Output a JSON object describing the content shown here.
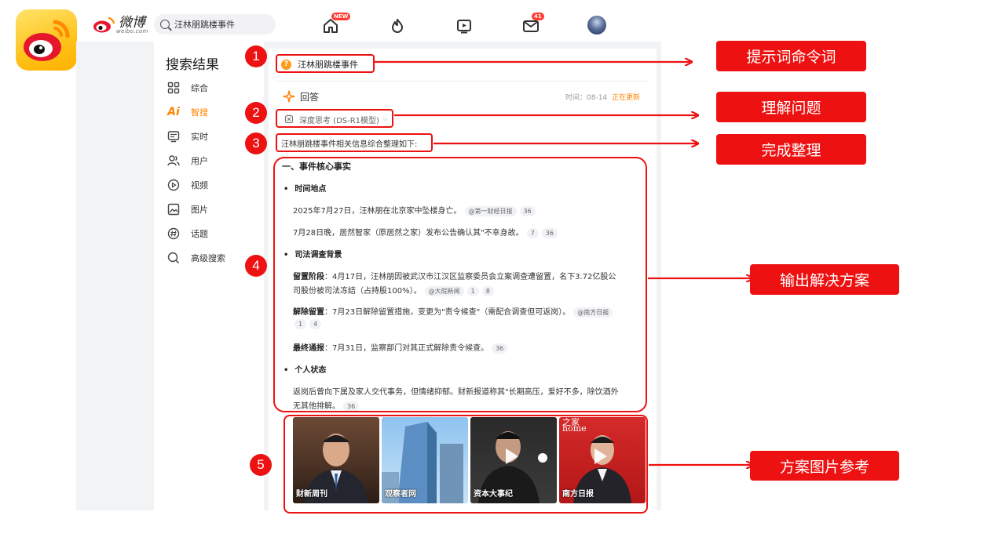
{
  "brand": {
    "name": "微博",
    "sub": "weibo.com"
  },
  "search": {
    "value": "汪林朋跳楼事件"
  },
  "nav": {
    "home_badge": "NEW",
    "mail_badge": "41"
  },
  "sidebar": {
    "title": "搜索结果",
    "items": [
      {
        "label": "综合",
        "icon": "grid-icon"
      },
      {
        "label": "智搜",
        "icon": "ai-icon"
      },
      {
        "label": "实时",
        "icon": "realtime-icon"
      },
      {
        "label": "用户",
        "icon": "users-icon"
      },
      {
        "label": "视频",
        "icon": "video-icon"
      },
      {
        "label": "图片",
        "icon": "image-icon"
      },
      {
        "label": "话题",
        "icon": "topic-icon"
      },
      {
        "label": "高级搜索",
        "icon": "search-icon"
      }
    ]
  },
  "main": {
    "query": "汪林朋跳楼事件",
    "answer_label": "回答",
    "time": "时间：08-14",
    "live": "正在更新",
    "think_label": "深度思考 (DS-R1模型)",
    "summary": "汪林朋跳楼事件相关信息综合整理如下:",
    "section1": "一、事件核心事实",
    "b1": "时间地点",
    "l1": "2025年7月27日，汪林朋在北京家中坠楼身亡。",
    "l1_tags": [
      "@第一财经日报",
      "36"
    ],
    "l2": "7月28日晚，居然智家（原居然之家）发布公告确认其\"不幸身故。",
    "l2_tags": [
      "7",
      "36"
    ],
    "b2": "司法调查背景",
    "p1_bold": "留置阶段",
    "p1_a": "：4月17日，汪林朋因被武汉市江汉区监察委员会立案调查遭留置，名下3.72亿股公",
    "p1_b": "司股份被司法冻结（占持股100%）。",
    "p1_tags": [
      "@大皖新闻",
      "1",
      "8"
    ],
    "p2_bold": "解除留置",
    "p2_a": "：7月23日解除留置措施，变更为\"责令候查\"（需配合调查但可返岗）。",
    "p2_tags": [
      "@南方日报",
      "1",
      "4"
    ],
    "p3_bold": "最终通报",
    "p3_a": "：7月31日，监察部门对其正式解除责令候查。",
    "p3_tags": [
      "36"
    ],
    "b3": "个人状态",
    "p4_a": "返岗后曾向下属及家人交代事务，但情绪抑郁。财新报道称其\"长期高压，爱好不多，除饮酒外",
    "p4_b": "无其他排解。",
    "p4_tags": [
      "36"
    ]
  },
  "images": [
    {
      "source": "财新周刊"
    },
    {
      "source": "观察者网"
    },
    {
      "source": "资本大事纪"
    },
    {
      "source": "南方日报"
    }
  ],
  "image_overlay_texts": [
    "之家",
    "home"
  ],
  "annotations": [
    {
      "num": "1",
      "label": "提示词命令词"
    },
    {
      "num": "2",
      "label": "理解问题"
    },
    {
      "num": "3",
      "label": "完成整理"
    },
    {
      "num": "4",
      "label": "输出解决方案"
    },
    {
      "num": "5",
      "label": "方案图片参考"
    }
  ],
  "colors": {
    "accent": "#ff8200",
    "annotation_red": "#ee1111"
  }
}
